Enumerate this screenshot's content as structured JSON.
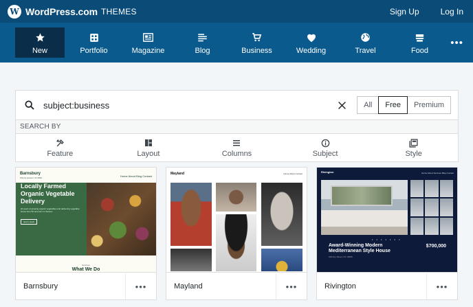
{
  "topbar": {
    "brand": "WordPress.com",
    "section": "THEMES",
    "links": [
      "Sign Up",
      "Log In"
    ]
  },
  "nav": {
    "items": [
      {
        "label": "New",
        "icon": "star-icon",
        "active": true
      },
      {
        "label": "Portfolio",
        "icon": "portfolio-icon"
      },
      {
        "label": "Magazine",
        "icon": "magazine-icon"
      },
      {
        "label": "Blog",
        "icon": "blog-icon"
      },
      {
        "label": "Business",
        "icon": "cart-icon"
      },
      {
        "label": "Wedding",
        "icon": "heart-icon"
      },
      {
        "label": "Travel",
        "icon": "globe-icon"
      },
      {
        "label": "Food",
        "icon": "food-icon"
      }
    ],
    "more": "•••"
  },
  "search": {
    "value": "subject:business",
    "segments": [
      "All",
      "Free",
      "Premium"
    ],
    "selected": "Free"
  },
  "searchby": {
    "label": "SEARCH BY",
    "filters": [
      {
        "label": "Feature",
        "icon": "tools-icon"
      },
      {
        "label": "Layout",
        "icon": "layout-icon"
      },
      {
        "label": "Columns",
        "icon": "columns-icon"
      },
      {
        "label": "Subject",
        "icon": "info-icon"
      },
      {
        "label": "Style",
        "icon": "style-icon"
      }
    ]
  },
  "cards": [
    {
      "name": "Barnsbury",
      "preview": {
        "site_title": "Barnsbury",
        "tagline": "Winnis Hostern 33 3899",
        "nav": "Home  About  Blog  Contact",
        "headline": "Locally Farmed Organic Vegetable Delivery",
        "body": "20 years of growing organic vegetables and delivering vegetable boxes from 50 acre farm in Sussex",
        "button": "Get in touch",
        "small": "Services",
        "section": "What We Do"
      }
    },
    {
      "name": "Mayland",
      "preview": {
        "site_title": "Mayland",
        "nav": "Home  About  Contact"
      }
    },
    {
      "name": "Rivington",
      "preview": {
        "site_title": "Rivington",
        "nav": "Home  About  Services  Blog  Contact",
        "headline": "Award-Winning Modern Mediterranean Style House",
        "address": "100 Any Street, NY 10005",
        "price": "$700,000",
        "dots": "• • • • • • •"
      }
    }
  ],
  "card_menu": "•••",
  "colors": {
    "topbar": "#0a4b78",
    "nav": "#0b5a8e",
    "nav_active": "#0a2e4a"
  }
}
